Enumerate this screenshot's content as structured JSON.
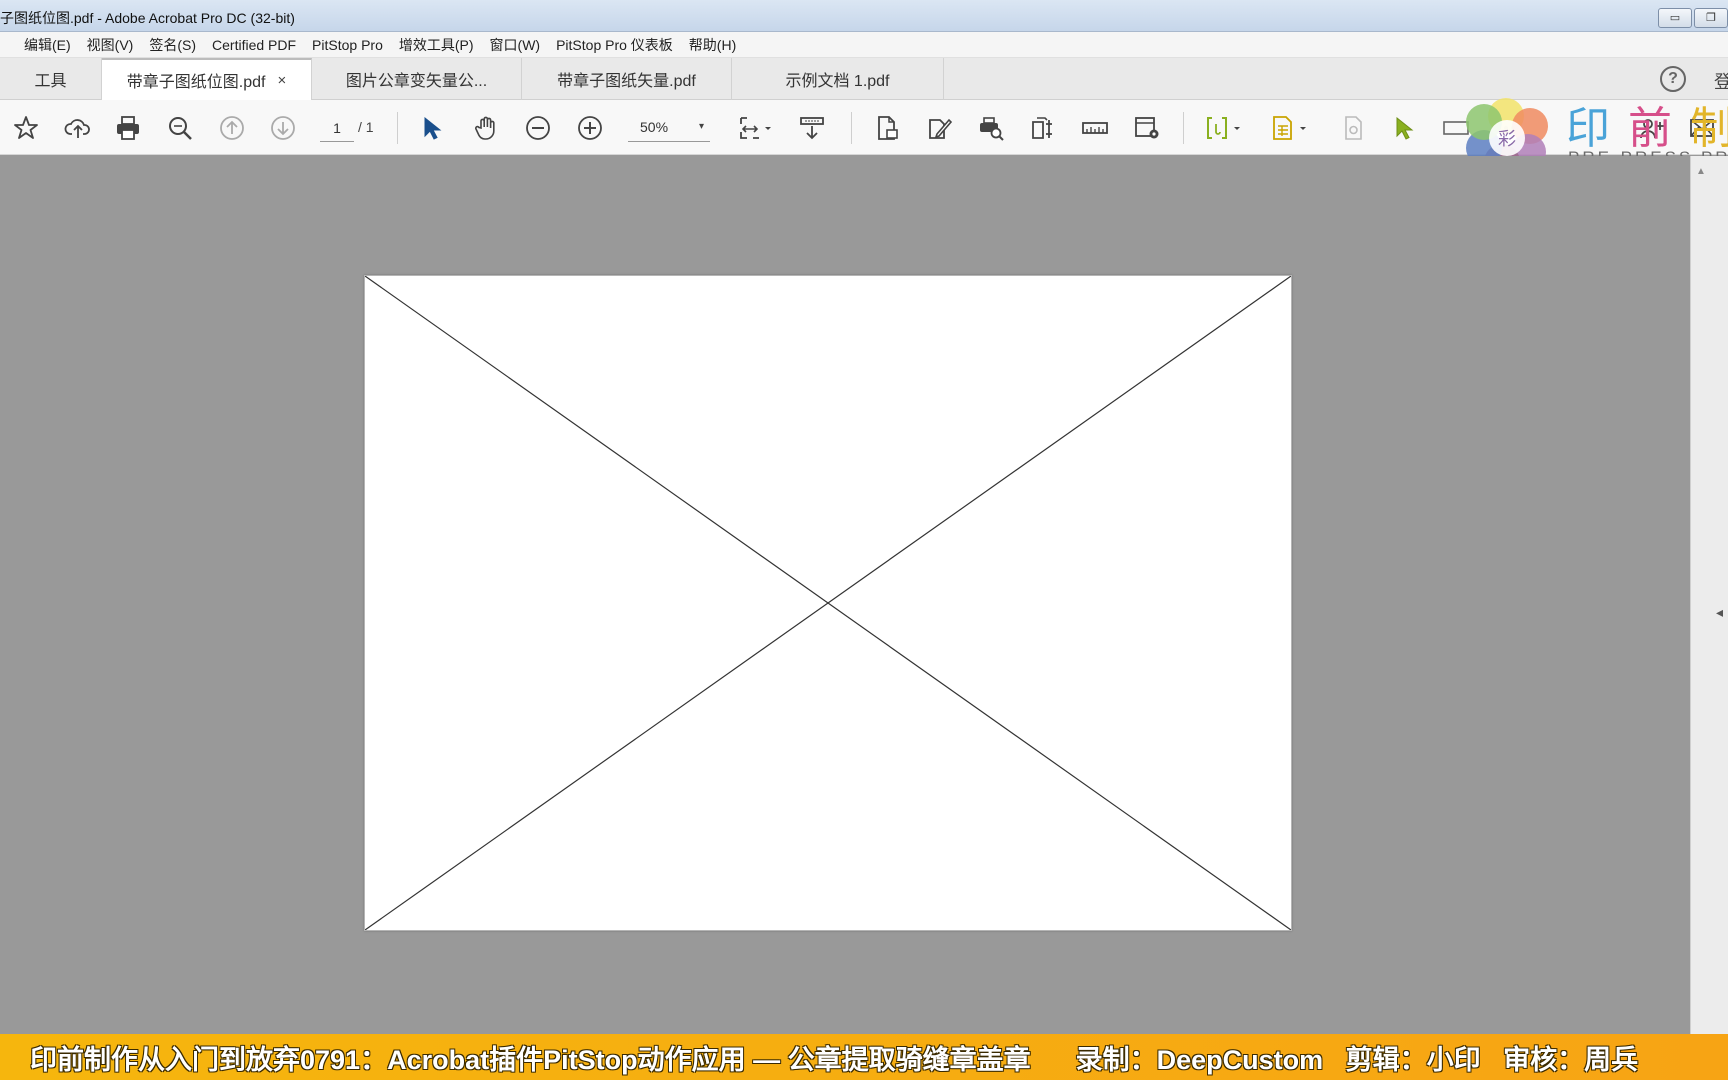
{
  "window": {
    "title": "子图纸位图.pdf - Adobe Acrobat Pro DC (32-bit)",
    "minimize": "▭",
    "restore": "❐"
  },
  "menu": [
    "编辑(E)",
    "视图(V)",
    "签名(S)",
    "Certified PDF",
    "PitStop Pro",
    "增效工具(P)",
    "窗口(W)",
    "PitStop Pro 仪表板",
    "帮助(H)"
  ],
  "tabs": {
    "tools": "工具",
    "docs": [
      "带章子图纸位图.pdf",
      "图片公章变矢量公...",
      "带章子图纸矢量.pdf",
      "示例文档 1.pdf"
    ],
    "close_glyph": "×",
    "help": "?",
    "login_fragment": "登"
  },
  "toolbar": {
    "page_current": "1",
    "page_total": "/ 1",
    "zoom": "50%",
    "zoom_caret": "▾"
  },
  "logo": {
    "text": "印前制",
    "subtitle": "PRE-PRESS  PRIN",
    "center_glyph": "彩"
  },
  "scroll": {
    "up_arrow": "▲",
    "panel_toggle": "◂"
  },
  "caption": {
    "main": "印前制作从入门到放弃0791：Acrobat插件PitStop动作应用 — 公章提取骑缝章盖章",
    "credits": "录制：DeepCustom   剪辑：小印   审核：周兵"
  },
  "colors": {
    "accent_blue": "#1a73c8",
    "select_green": "#8ab020",
    "caption_bg": "#f6b60d"
  }
}
